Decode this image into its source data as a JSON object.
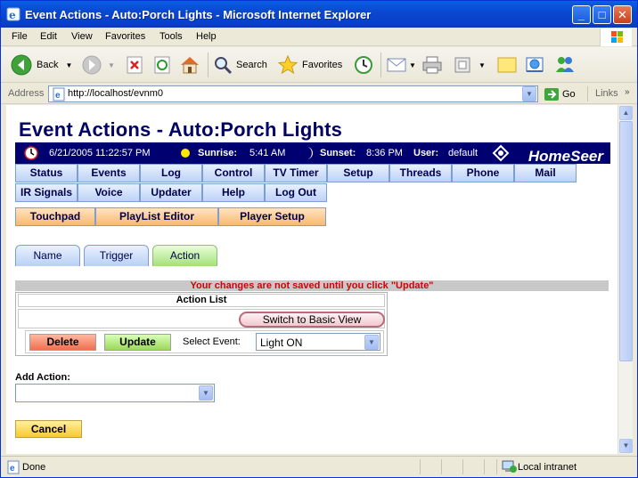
{
  "window": {
    "title": "Event Actions - Auto:Porch Lights - Microsoft Internet Explorer"
  },
  "menu": [
    "File",
    "Edit",
    "View",
    "Favorites",
    "Tools",
    "Help"
  ],
  "toolbar": {
    "back": "Back",
    "search": "Search",
    "favorites": "Favorites"
  },
  "address": {
    "label": "Address",
    "url": "http://localhost/evnm0",
    "go": "Go",
    "links": "Links"
  },
  "page": {
    "title": "Event Actions - Auto:Porch Lights",
    "info": {
      "datetime": "6/21/2005 11:22:57 PM",
      "sunrise_label": "Sunrise:",
      "sunrise": "5:41 AM",
      "sunset_label": "Sunset:",
      "sunset": "8:36 PM",
      "user_label": "User:",
      "user": "default",
      "brand": "HomeSeer"
    },
    "nav_row1": [
      "Status",
      "Events",
      "Log",
      "Control",
      "TV Timer",
      "Setup",
      "Threads",
      "Phone",
      "Mail"
    ],
    "nav_row2": [
      "IR Signals",
      "Voice",
      "Updater",
      "Help",
      "Log Out"
    ],
    "nav_row3": [
      "Touchpad",
      "PlayList Editor",
      "Player Setup"
    ],
    "tabs": [
      "Name",
      "Trigger",
      "Action"
    ],
    "warning": "Your changes are not saved until you click \"Update\"",
    "action_list": {
      "header": "Action List",
      "basic_view": "Switch to Basic View",
      "delete": "Delete",
      "update": "Update",
      "select_event_label": "Select Event:",
      "select_event_value": "Light ON"
    },
    "add_action_label": "Add Action:",
    "add_action_value": "",
    "cancel": "Cancel"
  },
  "status": {
    "text": "Done",
    "zone": "Local intranet"
  },
  "colors": {
    "title_blue": "#000066",
    "info_bar": "#000070",
    "warning_red": "#d50000",
    "nav_blue": "#bcd2f5",
    "nav_orange": "#f8b970"
  }
}
